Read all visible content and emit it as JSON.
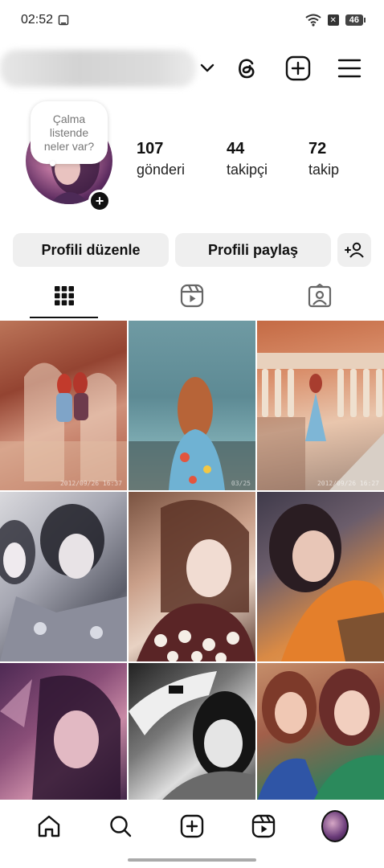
{
  "status_bar": {
    "time": "02:52",
    "battery": "46"
  },
  "header": {
    "username": ""
  },
  "profile": {
    "note_text": "Çalma\nlistende\nneler var?",
    "stats": [
      {
        "value": "107",
        "label": "gönderi"
      },
      {
        "value": "44",
        "label": "takipçi"
      },
      {
        "value": "72",
        "label": "takip"
      }
    ]
  },
  "buttons": {
    "edit_profile": "Profili düzenle",
    "share_profile": "Profili paylaş"
  },
  "tabs": [
    "grid-posts",
    "reels",
    "tagged"
  ],
  "grid": {
    "photos": [
      {
        "icon": "photo",
        "stamp": "2012/09/26 16:37"
      },
      {
        "icon": "photo",
        "stamp": "03/25"
      },
      {
        "icon": "photo",
        "stamp": "2012/09/26 16:27"
      },
      {
        "icon": "photo",
        "stamp": ""
      },
      {
        "icon": "photo",
        "stamp": ""
      },
      {
        "icon": "photo",
        "stamp": ""
      },
      {
        "icon": "photo",
        "stamp": ""
      },
      {
        "icon": "photo",
        "stamp": ""
      },
      {
        "icon": "photo",
        "stamp": ""
      }
    ]
  },
  "bottom_nav": [
    "home",
    "search",
    "create",
    "reels",
    "profile"
  ]
}
